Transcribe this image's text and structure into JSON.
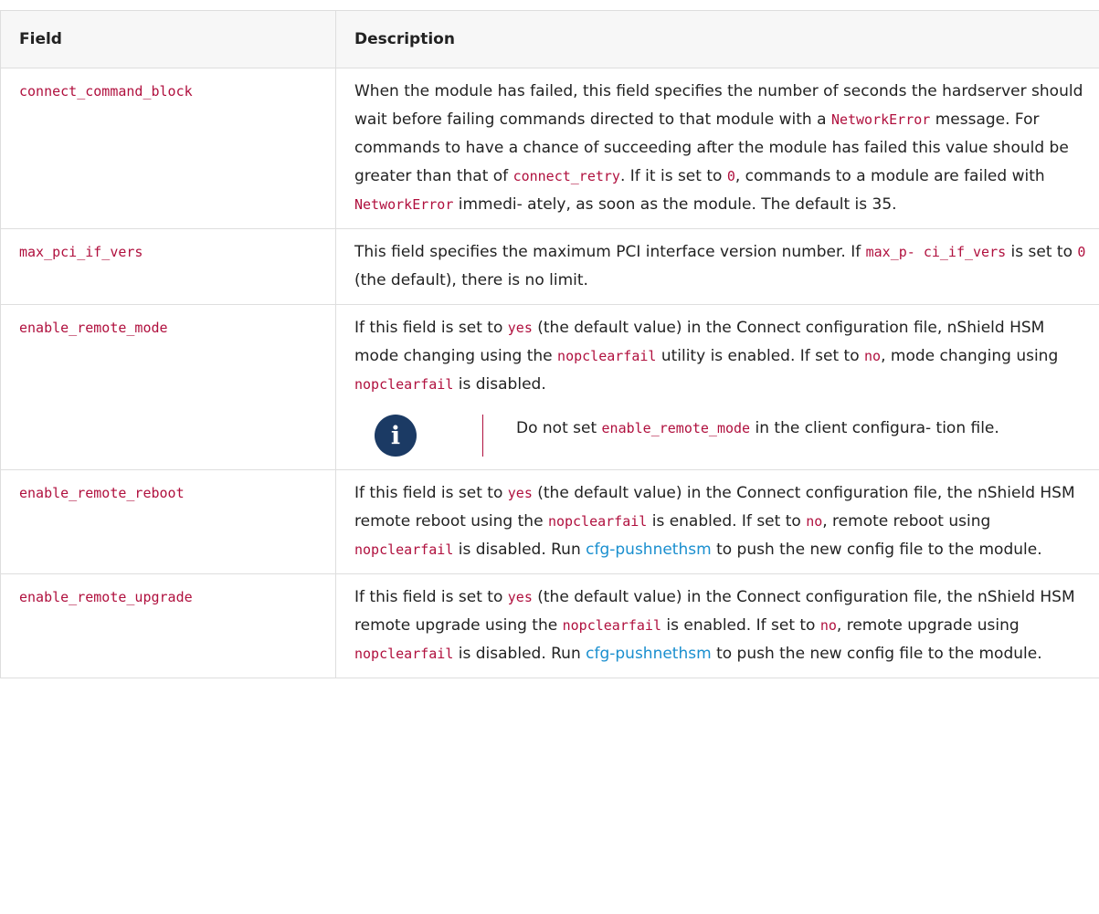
{
  "table": {
    "headers": [
      "Field",
      "Description"
    ],
    "rows": [
      {
        "field": "connect_command_block",
        "desc": {
          "t1": "When the module has failed, this field specifies the number of seconds the hardserver should wait before failing commands directed to that module with a ",
          "c1": "NetworkError",
          "t2": " message. For commands to have a chance of succeeding after the module has failed this value should be greater than that of ",
          "c2": "connect_retry",
          "t3": ". If it is set to ",
          "c3": "0",
          "t4": ", commands to a module are failed with ",
          "c4": "NetworkError",
          "t5": " immedi- ately, as soon as the module. The default is 35."
        }
      },
      {
        "field": "max_pci_if_vers",
        "desc": {
          "t1": "This field specifies the maximum PCI interface version number. If ",
          "c1": "max_p- ci_if_vers",
          "t2": " is set to ",
          "c2": "0",
          "t3": " (the default), there is no limit."
        }
      },
      {
        "field": "enable_remote_mode",
        "desc": {
          "t1": "If this field is set to ",
          "c1": "yes",
          "t2": " (the default value) in the Connect configuration file, nShield HSM mode changing using the ",
          "c2": "nopclearfail",
          "t3": " utility is enabled. If set to ",
          "c3": "no",
          "t4": ", mode changing using ",
          "c4": "nopclearfail",
          "t5": " is disabled."
        },
        "note": {
          "icon": "info-icon",
          "t1": "Do not set ",
          "c1": "enable_remote_mode",
          "t2": " in the client configura- tion file."
        }
      },
      {
        "field": "enable_remote_reboot",
        "desc": {
          "t1": "If this field is set to ",
          "c1": "yes",
          "t2": " (the default value) in the Connect configuration file, the nShield HSM remote reboot using the ",
          "c2": "nopclearfail",
          "t3": " is enabled. If set to ",
          "c3": "no",
          "t4": ", remote reboot using ",
          "c4": "nopclearfail",
          "t5": " is disabled. Run ",
          "l1": "cfg-pushnethsm",
          "t6": " to push the new config file to the module."
        }
      },
      {
        "field": "enable_remote_upgrade",
        "desc": {
          "t1": "If this field is set to ",
          "c1": "yes",
          "t2": " (the default value) in the Connect configuration file, the nShield HSM remote upgrade using the ",
          "c2": "nopclearfail",
          "t3": " is enabled. If set to ",
          "c3": "no",
          "t4": ", remote upgrade using ",
          "c4": "nopclearfail",
          "t5": " is disabled. Run ",
          "l1": "cfg-pushnethsm",
          "t6": " to push the new config file to the module."
        }
      }
    ]
  },
  "colors": {
    "code": "#b0103e",
    "link": "#1a8fcf",
    "icon_bg": "#1b3a64",
    "header_bg": "#f7f7f7"
  }
}
